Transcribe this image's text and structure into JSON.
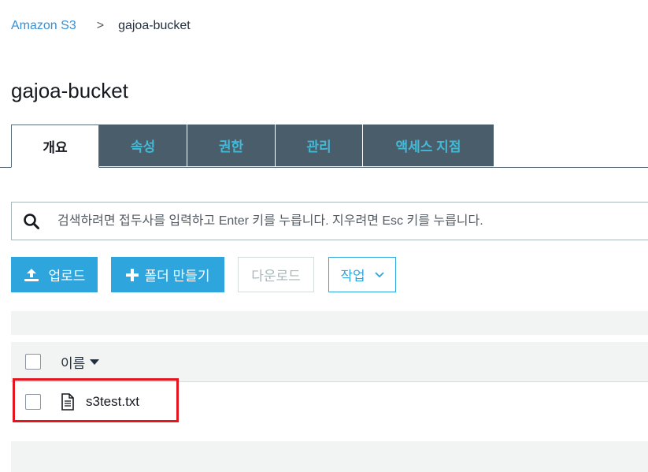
{
  "breadcrumb": {
    "root": "Amazon S3",
    "separator": ">",
    "current": "gajoa-bucket"
  },
  "page_title": "gajoa-bucket",
  "tabs": [
    {
      "label": "개요",
      "active": true
    },
    {
      "label": "속성",
      "active": false
    },
    {
      "label": "권한",
      "active": false
    },
    {
      "label": "관리",
      "active": false
    },
    {
      "label": "액세스 지점",
      "active": false
    }
  ],
  "search": {
    "placeholder": "검색하려면 접두사를 입력하고 Enter 키를 누릅니다. 지우려면 Esc 키를 누릅니다.",
    "icon": "search-icon"
  },
  "actions": {
    "upload_label": "업로드",
    "create_folder_label": "폴더 만들기",
    "download_label": "다운로드",
    "actions_label": "작업"
  },
  "table": {
    "column_name": "이름",
    "rows": [
      {
        "name": "s3test.txt",
        "icon": "text-file-icon"
      }
    ]
  },
  "colors": {
    "accent": "#2ea6dd",
    "tab_bg": "#4a5d6b",
    "tab_text": "#44b9d6",
    "highlight": "#e3161f"
  }
}
